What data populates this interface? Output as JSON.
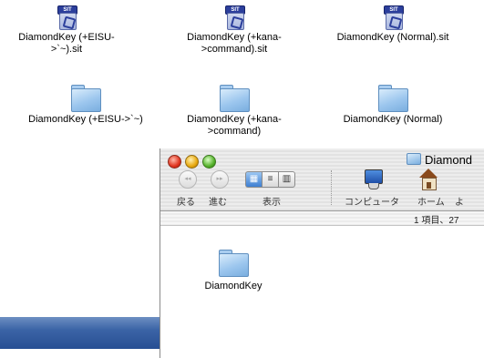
{
  "desktop_items": [
    {
      "label": "DiamondKey (+EISU-\n>`~).sit",
      "icon": "sit-archive-icon"
    },
    {
      "label": "DiamondKey (+kana-\n>command).sit",
      "icon": "sit-archive-icon"
    },
    {
      "label": "DiamondKey (Normal).sit",
      "icon": "sit-archive-icon"
    },
    {
      "label": "DiamondKey (+EISU->`~)",
      "icon": "folder-icon"
    },
    {
      "label": "DiamondKey (+kana-\n>command)",
      "icon": "folder-icon"
    },
    {
      "label": "DiamondKey (Normal)",
      "icon": "folder-icon"
    }
  ],
  "sit_tag": "SIT",
  "finder": {
    "title": "Diamond",
    "toolbar": {
      "back_label": "戻る",
      "forward_label": "進む",
      "view_label": "表示",
      "computer_label": "コンピュータ",
      "home_label": "ホーム",
      "partial_label": "よ",
      "view_icons": [
        "icon-view",
        "list-view",
        "column-view"
      ]
    },
    "status": "1 項目、27",
    "items": [
      {
        "label": "DiamondKey",
        "icon": "folder-icon"
      }
    ]
  },
  "colors": {
    "folder_blue": "#9cc6ee",
    "sit_tag": "#2c3f9c",
    "dock_blue": "#3b64a6"
  }
}
